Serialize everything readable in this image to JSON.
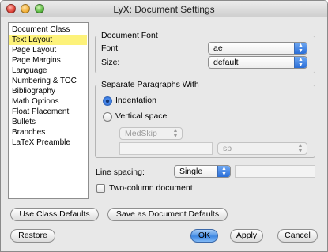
{
  "window": {
    "title": "LyX: Document Settings"
  },
  "sidebar": {
    "items": [
      {
        "label": "Document Class"
      },
      {
        "label": "Text Layout"
      },
      {
        "label": "Page Layout"
      },
      {
        "label": "Page Margins"
      },
      {
        "label": "Language"
      },
      {
        "label": "Numbering & TOC"
      },
      {
        "label": "Bibliography"
      },
      {
        "label": "Math Options"
      },
      {
        "label": "Float Placement"
      },
      {
        "label": "Bullets"
      },
      {
        "label": "Branches"
      },
      {
        "label": "LaTeX Preamble"
      }
    ],
    "selected_index": 1
  },
  "document_font": {
    "group_title": "Document Font",
    "font_label": "Font:",
    "font_value": "ae",
    "size_label": "Size:",
    "size_value": "default"
  },
  "separate_paragraphs": {
    "group_title": "Separate Paragraphs With",
    "indentation_label": "Indentation",
    "vertical_space_label": "Vertical space",
    "vspace_value": "MedSkip",
    "vspace_length": "",
    "vspace_unit": "sp",
    "selected": "indentation"
  },
  "line_spacing": {
    "label": "Line spacing:",
    "value": "Single",
    "custom_value": ""
  },
  "two_column": {
    "label": "Two-column document",
    "checked": false
  },
  "buttons": {
    "use_class_defaults": "Use Class Defaults",
    "save_as_defaults": "Save as Document Defaults",
    "restore": "Restore",
    "ok": "OK",
    "apply": "Apply",
    "cancel": "Cancel"
  }
}
